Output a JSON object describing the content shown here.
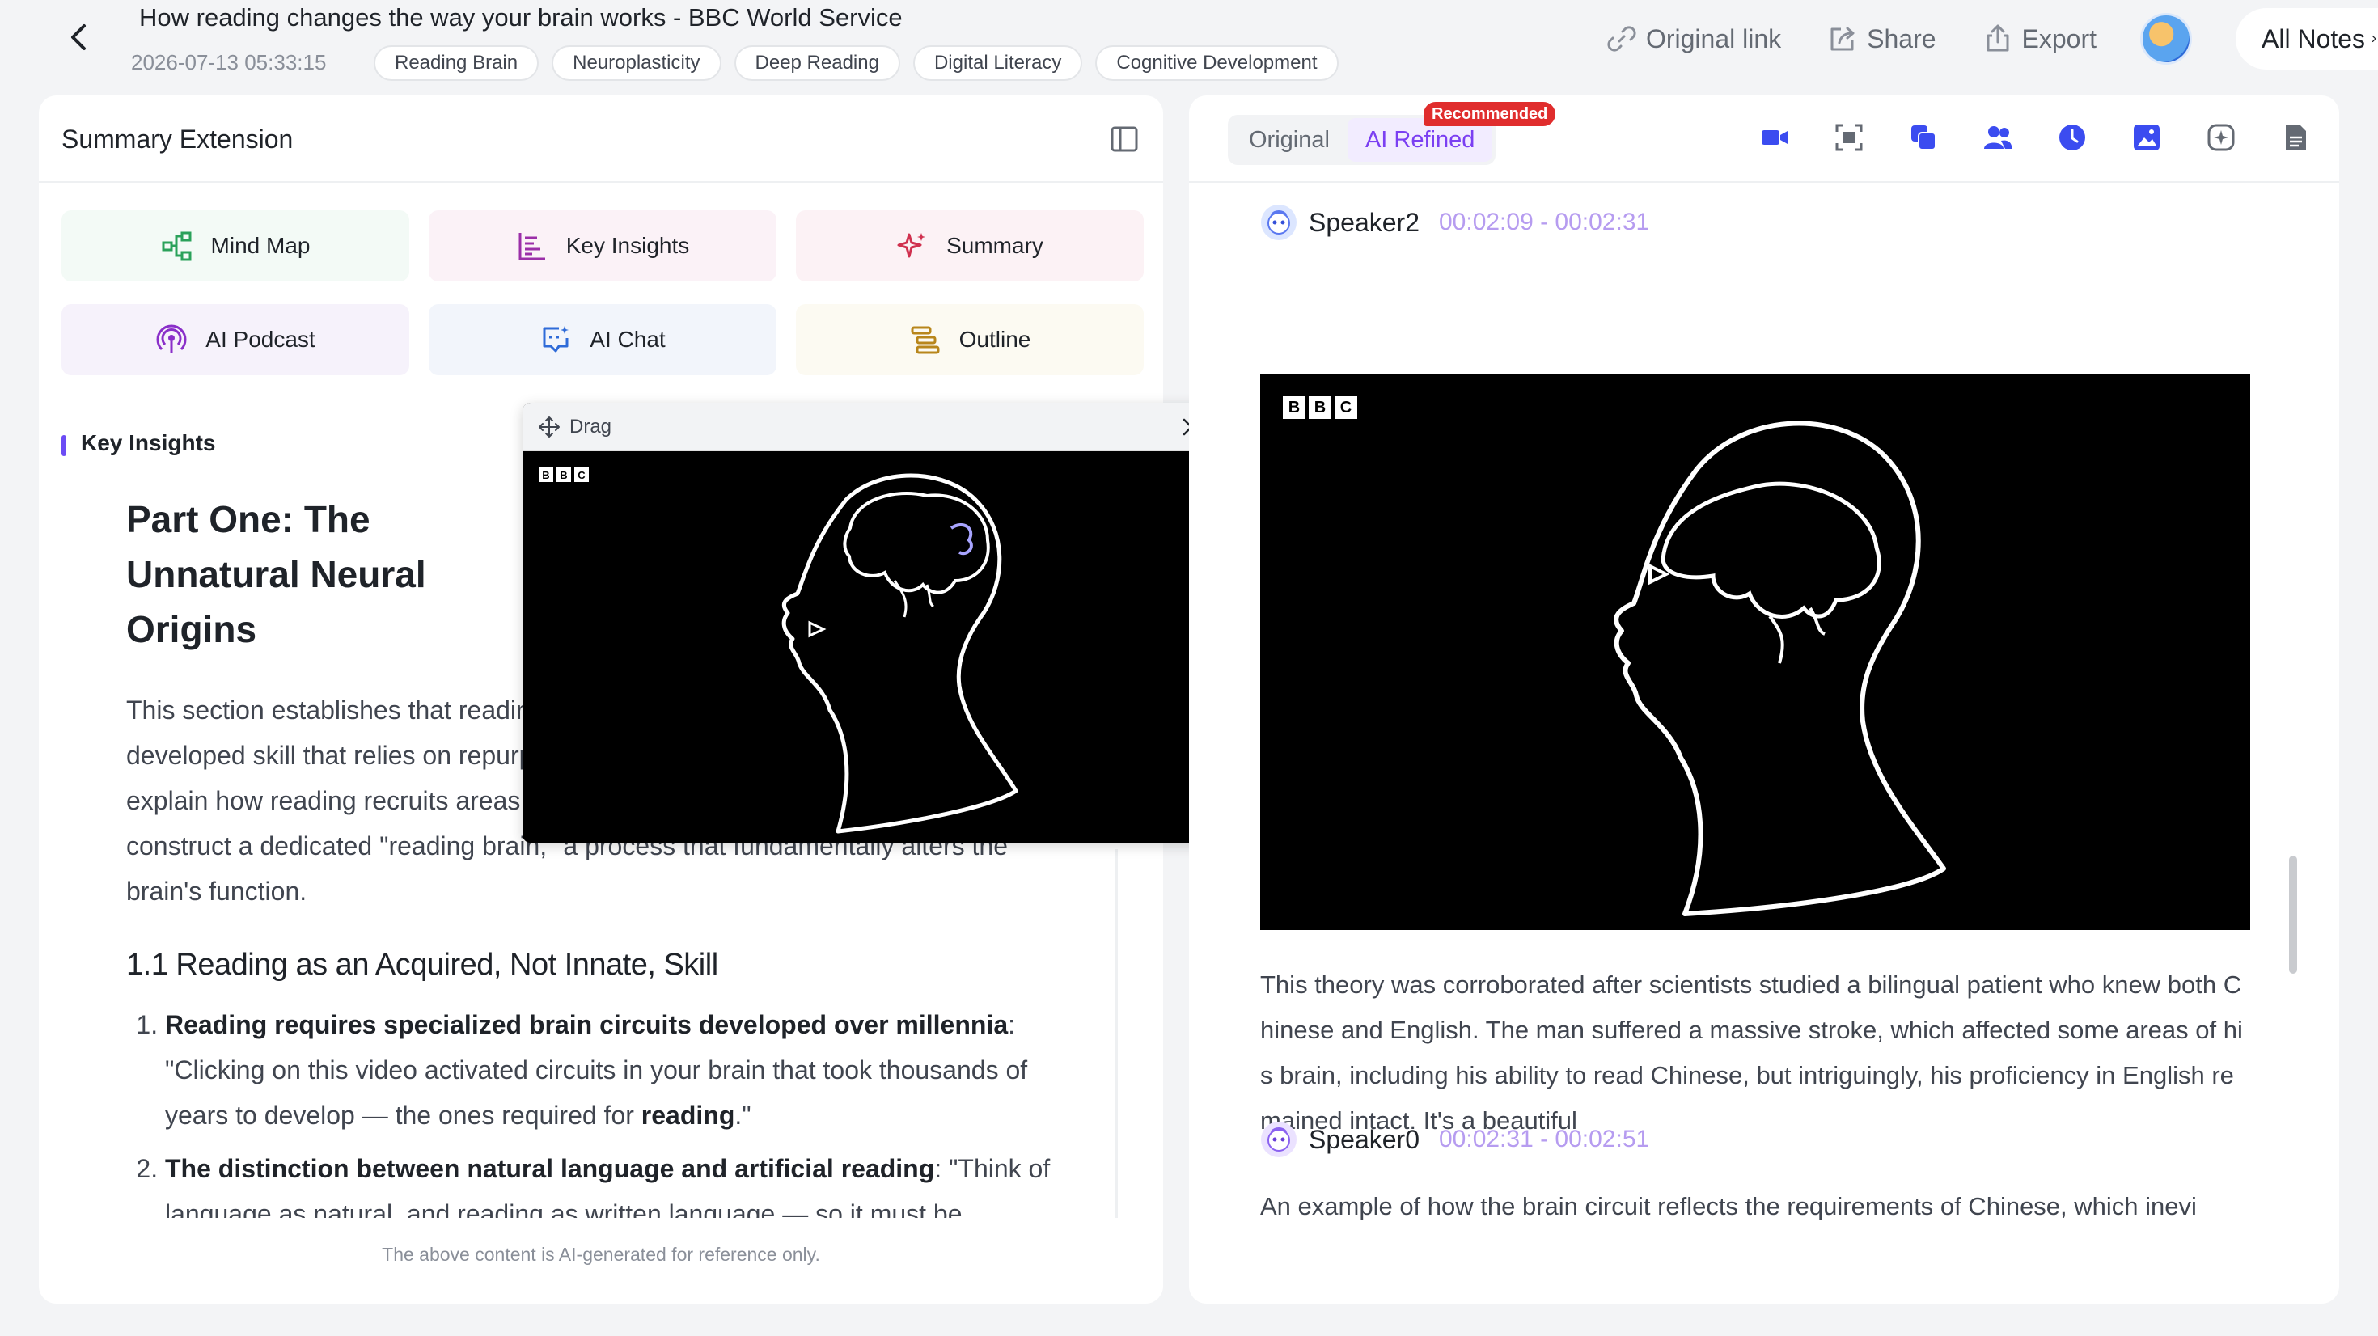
{
  "header": {
    "title": "How reading changes the way your brain works - BBC World Service",
    "date": "2026-07-13 05:33:15",
    "tags": [
      "Reading Brain",
      "Neuroplasticity",
      "Deep Reading",
      "Digital Literacy",
      "Cognitive Development"
    ],
    "actions": {
      "original_link": "Original link",
      "share": "Share",
      "export": "Export",
      "all_notes": "All Notes"
    }
  },
  "left_panel": {
    "title": "Summary Extension",
    "extensions": [
      {
        "label": "Mind Map",
        "icon": "mind-map-icon"
      },
      {
        "label": "Key Insights",
        "icon": "key-insights-icon"
      },
      {
        "label": "Summary",
        "icon": "sparkle-icon"
      },
      {
        "label": "AI Podcast",
        "icon": "podcast-icon"
      },
      {
        "label": "AI Chat",
        "icon": "ai-chat-icon"
      },
      {
        "label": "Outline",
        "icon": "outline-icon"
      }
    ],
    "section_label": "Key Insights",
    "heading": "Part One: The Unnatural Neural Origins",
    "body": "This section establishes that reading is not an innate ability but a culturally developed skill that relies on repurposing existing brain circuits. The speakers explain how reading recruits areas for vision, language, attention, and emotion to construct a dedicated \"reading brain,\" a process that fundamentally alters the brain's function.",
    "subheading": "1.1 Reading as an Acquired, Not Innate, Skill",
    "items": [
      {
        "bold": "Reading requires specialized brain circuits developed over millennia",
        "text_1": ": \"Clicking on this video activated circuits in your brain that took thousands of years to develop — the ones required for ",
        "bold_2": "reading",
        "text_2": ".\""
      },
      {
        "bold": "The distinction between natural language and artificial reading",
        "text_1": ": \"Think of language as natural, and reading as written language — so it must be"
      }
    ],
    "disclaimer": "The above content is AI-generated for reference only."
  },
  "float_video": {
    "drag_label": "Drag",
    "logo": [
      "B",
      "B",
      "C"
    ]
  },
  "right_panel": {
    "tabs": {
      "original": "Original",
      "refined": "AI Refined",
      "badge": "Recommended"
    },
    "tools": [
      "video-icon",
      "screenshot-icon",
      "copy-icon",
      "speakers-icon",
      "clock-icon",
      "image-icon",
      "ai-icon",
      "document-icon"
    ],
    "segments": [
      {
        "speaker": "Speaker2",
        "time": "00:02:09 - 00:02:31",
        "text": "This theory was corroborated after scientists studied a bilingual patient who knew both Chinese and English. The man suffered a massive stroke, which affected some areas of his brain, including his ability to read Chinese, but intriguingly, his proficiency in English remained intact. It's a beautiful"
      },
      {
        "speaker": "Speaker0",
        "time": "00:02:31 - 00:02:51",
        "text": "An example of how the brain circuit reflects the requirements of Chinese, which inevi"
      }
    ],
    "logo": [
      "B",
      "B",
      "C"
    ]
  },
  "colors": {
    "accent": "#7b3ff2",
    "badge": "#e02d2d",
    "tool_blue": "#3b4cf0",
    "speaker_time": "#b69cf0"
  }
}
